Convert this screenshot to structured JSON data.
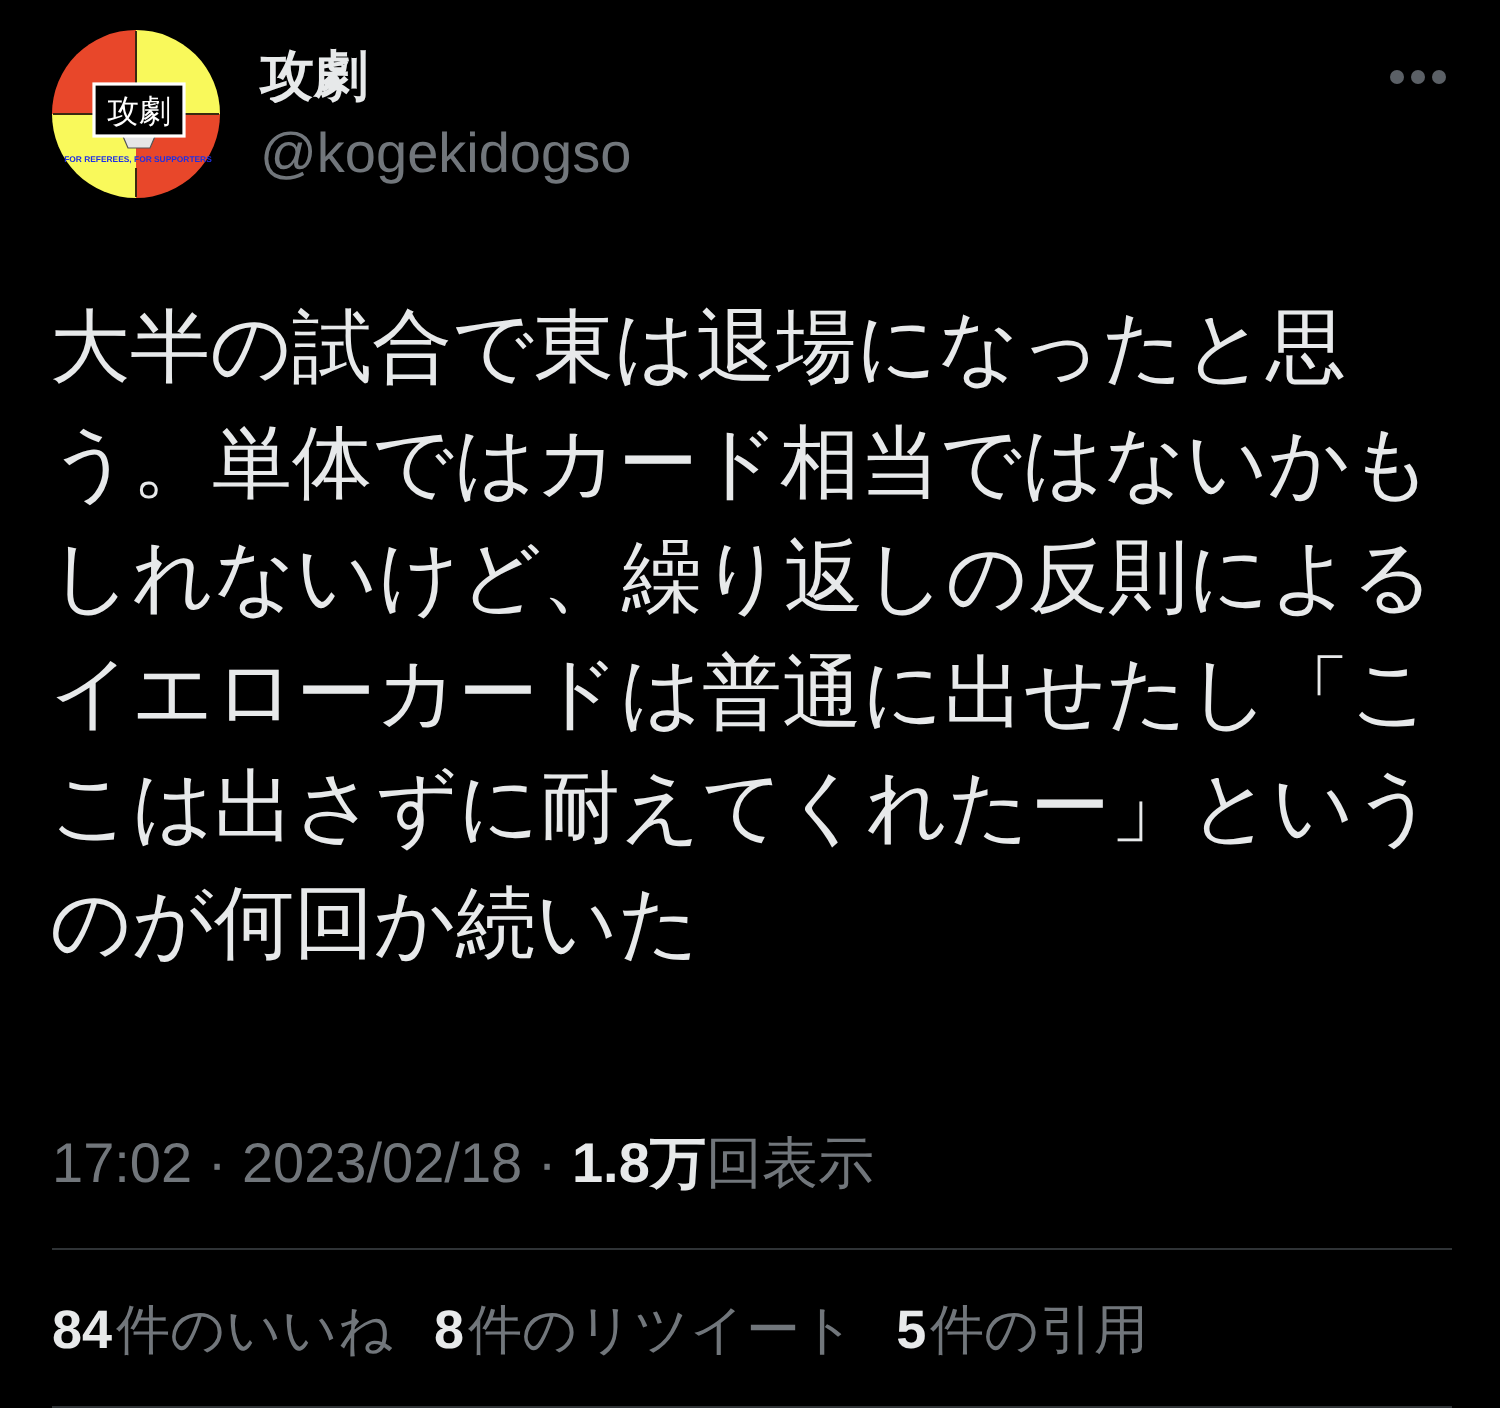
{
  "author": {
    "display_name": "攻劇",
    "handle": "@kogekidogso",
    "avatar": {
      "logo_text": "攻劇",
      "tagline": "FOR REFEREES, FOR SUPPORTERS"
    }
  },
  "tweet": {
    "text": "大半の試合で東は退場になったと思う。単体ではカード相当ではないかもしれないけど、繰り返しの反則によるイエローカードは普通に出せたし「ここは出さずに耐えてくれたー」というのが何回か続いた"
  },
  "meta": "17:02 · 2023/02/18 · **1.8万**回表示",
  "stats": [
    {
      "count": "84",
      "label": "件のいいね"
    },
    {
      "count": "8",
      "label": "件のリツイート"
    },
    {
      "count": "5",
      "label": "件の引用"
    }
  ]
}
